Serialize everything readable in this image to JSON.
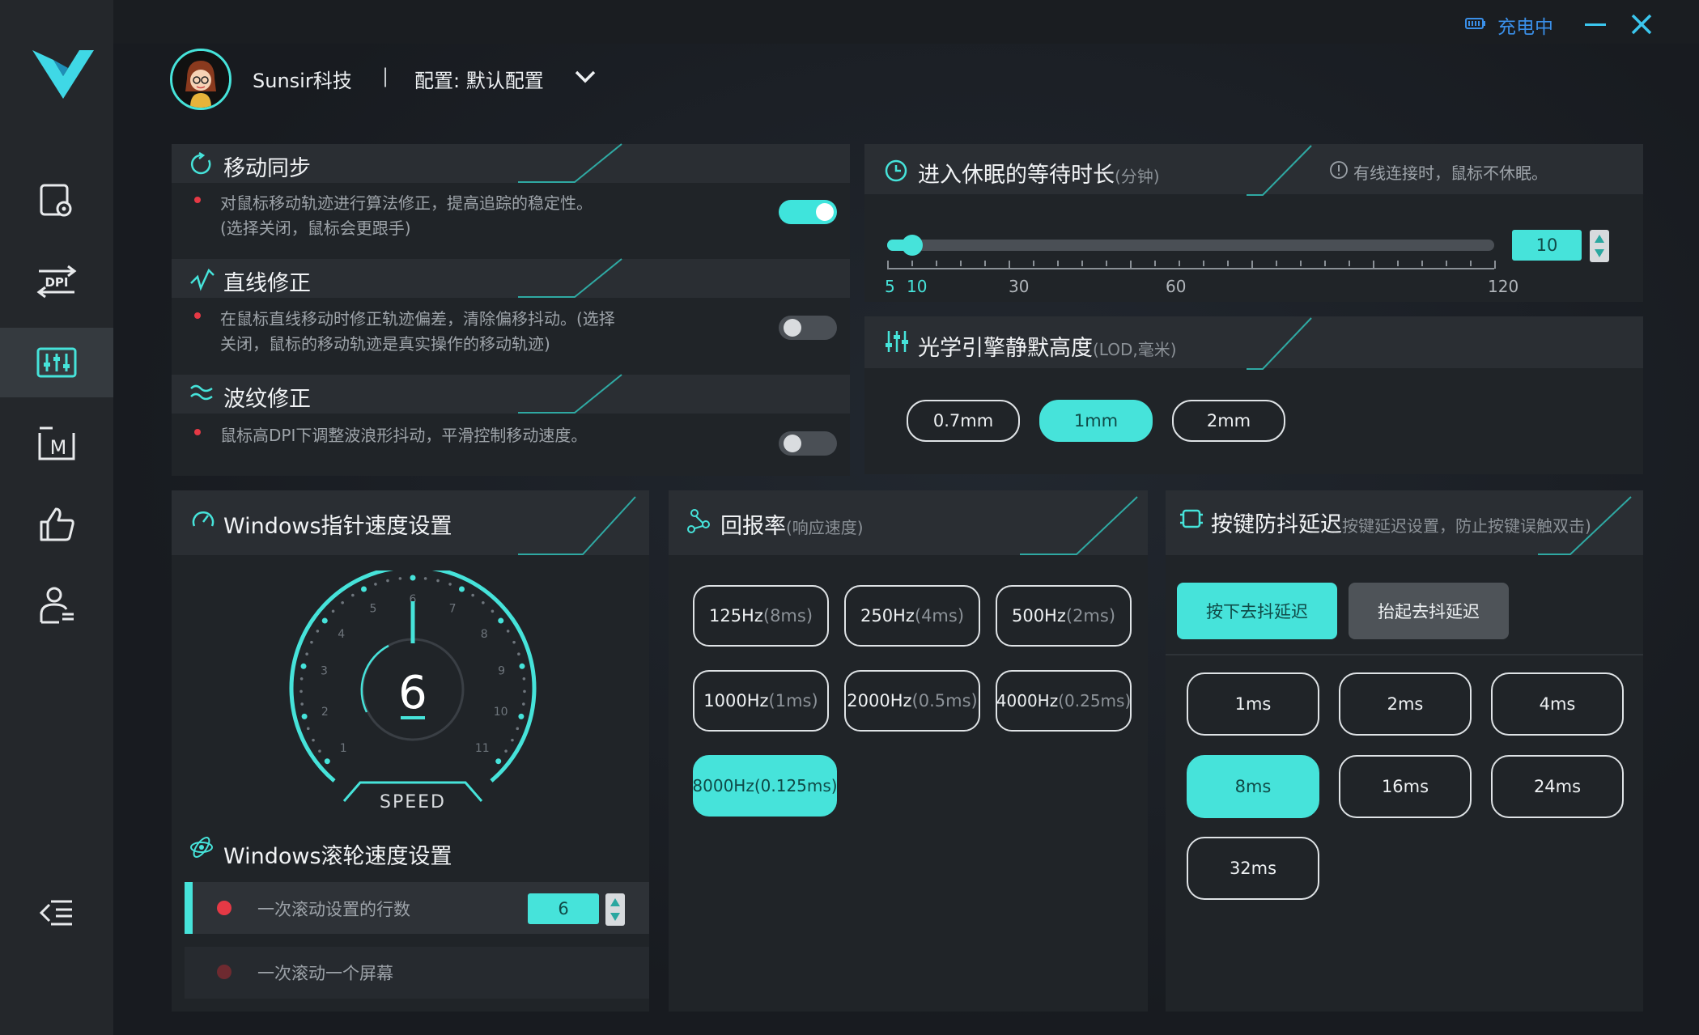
{
  "window": {
    "status_text": "充电中",
    "minimize_label": "—",
    "close_label": "✕"
  },
  "header": {
    "username": "Sunsir科技",
    "separator": "|",
    "config_label": "配置: 默认配置"
  },
  "sidebar": {
    "items": [
      {
        "icon": "screen-settings-icon"
      },
      {
        "icon": "dpi-icon",
        "label": "DPI"
      },
      {
        "icon": "equalizer-icon"
      },
      {
        "icon": "macro-icon",
        "label": "M"
      },
      {
        "icon": "thumbs-up-icon"
      },
      {
        "icon": "user-profile-icon"
      }
    ],
    "active_index": 2,
    "collapse_icon": "collapse-menu-icon"
  },
  "motion_sync": {
    "title": "移动同步",
    "desc": "对鼠标移动轨迹进行算法修正，提高追踪的稳定性。(选择关闭，鼠标会更跟手)",
    "enabled": true
  },
  "line_correction": {
    "title": "直线修正",
    "desc": "在鼠标直线移动时修正轨迹偏差，清除偏移抖动。(选择关闭，鼠标的移动轨迹是真实操作的移动轨迹)",
    "enabled": false
  },
  "ripple_correction": {
    "title": "波纹修正",
    "desc": "鼠标高DPI下调整波浪形抖动，平滑控制移动速度。",
    "enabled": false
  },
  "sleep": {
    "title": "进入休眠的等待时长",
    "unit": "(分钟)",
    "note": "有线连接时，鼠标不休眠。",
    "value": "10",
    "min": 5,
    "max": 120,
    "current": 10,
    "tick_labels": [
      "5",
      "10",
      "30",
      "60",
      "120"
    ]
  },
  "lod": {
    "title": "光学引擎静默高度",
    "unit": "(LOD,毫米)",
    "options": [
      "0.7mm",
      "1mm",
      "2mm"
    ],
    "selected": 1
  },
  "pointer_speed": {
    "title": "Windows指针速度设置",
    "value": "6",
    "gauge_label": "SPEED",
    "gauge_numbers": [
      "1",
      "2",
      "3",
      "4",
      "5",
      "6",
      "7",
      "8",
      "9",
      "10",
      "11"
    ]
  },
  "scroll": {
    "title": "Windows滚轮速度设置",
    "options": [
      {
        "label": "一次滚动设置的行数",
        "value": "6"
      },
      {
        "label": "一次滚动一个屏幕"
      }
    ],
    "selected": 0
  },
  "polling": {
    "title": "回报率",
    "unit": "(响应速度)",
    "options": [
      {
        "main": "125Hz",
        "sub": "(8ms)"
      },
      {
        "main": "250Hz",
        "sub": "(4ms)"
      },
      {
        "main": "500Hz",
        "sub": "(2ms)"
      },
      {
        "main": "1000Hz",
        "sub": "(1ms)"
      },
      {
        "main": "2000Hz",
        "sub": "(0.5ms)"
      },
      {
        "main": "4000Hz",
        "sub": "(0.25ms)"
      },
      {
        "main": "8000Hz",
        "sub": "(0.125ms)"
      }
    ],
    "selected": 6
  },
  "debounce": {
    "title": "按键防抖延迟",
    "subtitle": "按键延迟设置，防止按键误触双击)",
    "tabs": [
      "按下去抖延迟",
      "抬起去抖延迟"
    ],
    "active_tab": 0,
    "options": [
      "1ms",
      "2ms",
      "4ms",
      "8ms",
      "16ms",
      "24ms",
      "32ms"
    ],
    "selected": 3
  },
  "colors": {
    "accent": "#46e3da",
    "panel": "#202428",
    "sidebar": "#24272b",
    "danger": "#e53945"
  }
}
